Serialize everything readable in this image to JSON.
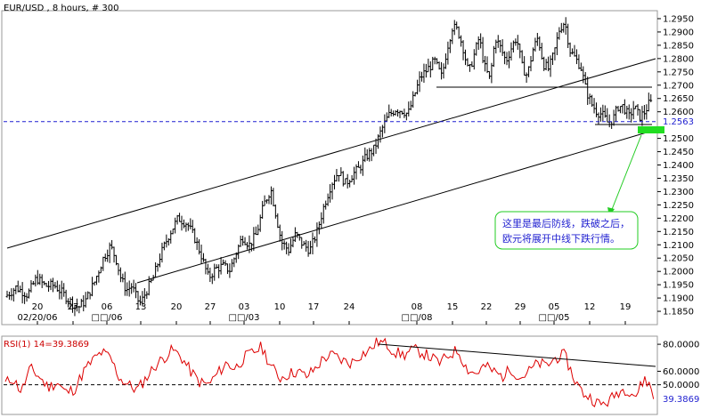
{
  "chart_data": [
    {
      "type": "ohlc",
      "title": "EUR/USD , 8 hours, # 300",
      "ylim": [
        1.18,
        1.298
      ],
      "y_ticks": [
        "1.2950",
        "1.2900",
        "1.2850",
        "1.2800",
        "1.2750",
        "1.2700",
        "1.2650",
        "1.2600",
        "1.2500",
        "1.2450",
        "1.2400",
        "1.2350",
        "1.2300",
        "1.2250",
        "1.2200",
        "1.2150",
        "1.2100",
        "1.2050",
        "1.2000",
        "1.1950",
        "1.1900",
        "1.1850"
      ],
      "x_day_labels": [
        "20",
        "27",
        "06",
        "13",
        "20",
        "27",
        "03",
        "10",
        "17",
        "24",
        "08",
        "15",
        "22",
        "29",
        "05",
        "12",
        "19"
      ],
      "x_month_labels": [
        "02/20/06",
        "□□/06",
        "□□/03",
        "□□/08",
        "□□/05"
      ],
      "current_price": "1.2563",
      "current_value": 1.2563,
      "price_path": [
        [
          0,
          1.1905
        ],
        [
          12,
          1.194
        ],
        [
          25,
          1.1912
        ],
        [
          35,
          1.1975
        ],
        [
          45,
          1.1945
        ],
        [
          55,
          1.1948
        ],
        [
          65,
          1.1915
        ],
        [
          75,
          1.188
        ],
        [
          82,
          1.1865
        ],
        [
          90,
          1.189
        ],
        [
          100,
          1.196
        ],
        [
          110,
          1.205
        ],
        [
          118,
          1.2095
        ],
        [
          124,
          1.205
        ],
        [
          130,
          1.197
        ],
        [
          136,
          1.193
        ],
        [
          142,
          1.1945
        ],
        [
          148,
          1.1895
        ],
        [
          152,
          1.188
        ],
        [
          158,
          1.1925
        ],
        [
          166,
          1.1975
        ],
        [
          174,
          1.206
        ],
        [
          184,
          1.214
        ],
        [
          194,
          1.22
        ],
        [
          204,
          1.218
        ],
        [
          212,
          1.213
        ],
        [
          220,
          1.206
        ],
        [
          228,
          1.1975
        ],
        [
          236,
          1.201
        ],
        [
          244,
          1.202
        ],
        [
          252,
          1.2005
        ],
        [
          258,
          1.206
        ],
        [
          266,
          1.213
        ],
        [
          274,
          1.21
        ],
        [
          282,
          1.214
        ],
        [
          290,
          1.225
        ],
        [
          298,
          1.231
        ],
        [
          304,
          1.221
        ],
        [
          310,
          1.211
        ],
        [
          318,
          1.208
        ],
        [
          326,
          1.214
        ],
        [
          334,
          1.21
        ],
        [
          342,
          1.208
        ],
        [
          350,
          1.215
        ],
        [
          358,
          1.225
        ],
        [
          366,
          1.233
        ],
        [
          374,
          1.2375
        ],
        [
          382,
          1.233
        ],
        [
          390,
          1.2365
        ],
        [
          398,
          1.239
        ],
        [
          406,
          1.2435
        ],
        [
          414,
          1.246
        ],
        [
          422,
          1.253
        ],
        [
          430,
          1.2585
        ],
        [
          438,
          1.261
        ],
        [
          446,
          1.2605
        ],
        [
          452,
          1.259
        ],
        [
          458,
          1.265
        ],
        [
          466,
          1.273
        ],
        [
          474,
          1.276
        ],
        [
          482,
          1.279
        ],
        [
          490,
          1.273
        ],
        [
          496,
          1.284
        ],
        [
          502,
          1.292
        ],
        [
          508,
          1.2905
        ],
        [
          514,
          1.284
        ],
        [
          520,
          1.2745
        ],
        [
          526,
          1.281
        ],
        [
          532,
          1.288
        ],
        [
          538,
          1.277
        ],
        [
          544,
          1.272
        ],
        [
          550,
          1.288
        ],
        [
          556,
          1.284
        ],
        [
          562,
          1.279
        ],
        [
          568,
          1.284
        ],
        [
          574,
          1.288
        ],
        [
          580,
          1.277
        ],
        [
          586,
          1.2735
        ],
        [
          592,
          1.283
        ],
        [
          598,
          1.288
        ],
        [
          604,
          1.278
        ],
        [
          610,
          1.276
        ],
        [
          616,
          1.282
        ],
        [
          622,
          1.291
        ],
        [
          628,
          1.294
        ],
        [
          634,
          1.283
        ],
        [
          640,
          1.28
        ],
        [
          646,
          1.277
        ],
        [
          652,
          1.268
        ],
        [
          658,
          1.263
        ],
        [
          664,
          1.26
        ],
        [
          670,
          1.259
        ],
        [
          676,
          1.256
        ],
        [
          682,
          1.257
        ],
        [
          688,
          1.262
        ],
        [
          694,
          1.262
        ],
        [
          700,
          1.258
        ],
        [
          706,
          1.262
        ],
        [
          712,
          1.258
        ],
        [
          718,
          1.26
        ],
        [
          724,
          1.264
        ],
        [
          730,
          1.259
        ],
        [
          735,
          1.2563
        ]
      ],
      "rsi": {
        "title": "RSI(1) 14=39.3869",
        "current": "39.3869",
        "ylim": [
          28,
          86
        ],
        "y_ticks": [
          "80.0000",
          "60.0000",
          "50.0000"
        ],
        "reference_level": 50,
        "path": [
          [
            0,
            50
          ],
          [
            10,
            55
          ],
          [
            20,
            45
          ],
          [
            30,
            62
          ],
          [
            40,
            56
          ],
          [
            50,
            48
          ],
          [
            60,
            52
          ],
          [
            70,
            44
          ],
          [
            80,
            47
          ],
          [
            90,
            60
          ],
          [
            100,
            68
          ],
          [
            110,
            74
          ],
          [
            120,
            70
          ],
          [
            130,
            55
          ],
          [
            140,
            50
          ],
          [
            150,
            46
          ],
          [
            160,
            55
          ],
          [
            170,
            64
          ],
          [
            180,
            70
          ],
          [
            190,
            76
          ],
          [
            200,
            70
          ],
          [
            210,
            60
          ],
          [
            220,
            52
          ],
          [
            230,
            50
          ],
          [
            240,
            58
          ],
          [
            250,
            66
          ],
          [
            260,
            62
          ],
          [
            270,
            70
          ],
          [
            280,
            74
          ],
          [
            290,
            78
          ],
          [
            300,
            64
          ],
          [
            310,
            55
          ],
          [
            320,
            58
          ],
          [
            330,
            60
          ],
          [
            340,
            56
          ],
          [
            350,
            62
          ],
          [
            360,
            70
          ],
          [
            370,
            72
          ],
          [
            380,
            68
          ],
          [
            390,
            66
          ],
          [
            400,
            72
          ],
          [
            410,
            75
          ],
          [
            420,
            82
          ],
          [
            430,
            80
          ],
          [
            440,
            74
          ],
          [
            450,
            72
          ],
          [
            460,
            76
          ],
          [
            470,
            74
          ],
          [
            480,
            70
          ],
          [
            490,
            66
          ],
          [
            500,
            72
          ],
          [
            510,
            76
          ],
          [
            520,
            62
          ],
          [
            530,
            58
          ],
          [
            540,
            64
          ],
          [
            550,
            60
          ],
          [
            560,
            56
          ],
          [
            570,
            62
          ],
          [
            580,
            55
          ],
          [
            590,
            60
          ],
          [
            600,
            66
          ],
          [
            610,
            64
          ],
          [
            620,
            70
          ],
          [
            630,
            72
          ],
          [
            640,
            55
          ],
          [
            650,
            44
          ],
          [
            660,
            40
          ],
          [
            670,
            35
          ],
          [
            680,
            38
          ],
          [
            690,
            45
          ],
          [
            700,
            47
          ],
          [
            710,
            42
          ],
          [
            720,
            55
          ],
          [
            728,
            46
          ],
          [
            735,
            39.39
          ]
        ]
      }
    }
  ],
  "annotation": {
    "line1": "这里是最后防线，跌破之后，",
    "line2": "欧元将展开中线下跌行情。"
  }
}
